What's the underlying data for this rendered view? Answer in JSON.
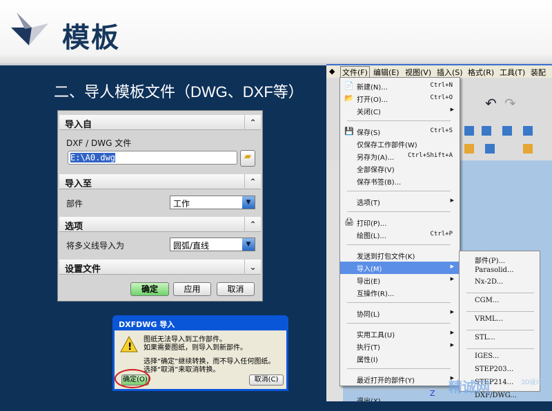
{
  "slide": {
    "title": "模板",
    "subtitle": "二、导人模板文件（DWG、DXF等）"
  },
  "nx_dialog": {
    "sections": [
      {
        "label": "导入自",
        "toggle": "⌃"
      },
      {
        "label": "导入至",
        "toggle": "⌃"
      },
      {
        "label": "选项",
        "toggle": "⌃"
      },
      {
        "label": "设置文件",
        "toggle": "⌄"
      }
    ],
    "file_label": "DXF / DWG 文件",
    "file_value": "E:\\A0.dwg",
    "part_label": "部件",
    "part_value": "工作",
    "polyline_label": "将多义线导入为",
    "polyline_value": "圆弧/直线",
    "buttons": {
      "ok": "确定",
      "apply": "应用",
      "cancel": "取消"
    }
  },
  "alert": {
    "title": "DXFDWG 导入",
    "lines": [
      "图纸无法导入到工作部件。",
      "如果需要图纸，则导入到新部件。",
      "选择“确定”继续转换，而不导入任何图纸。",
      "选择“取消”来取消转换。"
    ],
    "ok": "确定(O)",
    "cancel": "取消(C)"
  },
  "nx": {
    "menubar": [
      "文件(F)",
      "编辑(E)",
      "视图(V)",
      "插入(S)",
      "格式(R)",
      "工具(T)",
      "装配"
    ],
    "file_menu": [
      {
        "label": "新建(N)...",
        "shortcut": "Ctrl+N",
        "icon": "📄"
      },
      {
        "label": "打开(O)...",
        "shortcut": "Ctrl+O",
        "icon": "📂"
      },
      {
        "label": "关闭(C)",
        "arrow": "▶"
      },
      {
        "sep": true
      },
      {
        "label": "保存(S)",
        "shortcut": "Ctrl+S",
        "icon": "💾"
      },
      {
        "label": "仅保存工作部件(W)"
      },
      {
        "label": "另存为(A)...",
        "shortcut": "Ctrl+Shift+A"
      },
      {
        "label": "全部保存(V)"
      },
      {
        "label": "保存书签(B)..."
      },
      {
        "sep": true
      },
      {
        "label": "选项(T)",
        "arrow": "▶"
      },
      {
        "sep": true
      },
      {
        "label": "打印(P)...",
        "icon": "🖨"
      },
      {
        "label": "绘图(L)...",
        "shortcut": "Ctrl+P"
      },
      {
        "sep": true
      },
      {
        "label": "发送到打包文件(K)"
      },
      {
        "label": "导入(M)",
        "arrow": "▶",
        "highlight": true
      },
      {
        "label": "导出(E)",
        "arrow": "▶"
      },
      {
        "label": "互操作(R)..."
      },
      {
        "sep": true
      },
      {
        "label": "协同(L)",
        "arrow": "▶"
      },
      {
        "sep": true
      },
      {
        "label": "实用工具(U)",
        "arrow": "▶"
      },
      {
        "label": "执行(T)",
        "arrow": "▶"
      },
      {
        "label": "属性(I)"
      },
      {
        "sep": true
      },
      {
        "label": "最近打开的部件(Y)",
        "arrow": "▶"
      },
      {
        "sep": true
      },
      {
        "label": "退出(X)"
      }
    ],
    "import_submenu": [
      {
        "label": "部件(P)..."
      },
      {
        "label": "Parasolid..."
      },
      {
        "label": "Nx-2D..."
      },
      {
        "sep": true
      },
      {
        "label": "CGM..."
      },
      {
        "sep": true
      },
      {
        "label": "VRML..."
      },
      {
        "sep": true
      },
      {
        "label": "STL..."
      },
      {
        "sep": true
      },
      {
        "label": "IGES..."
      },
      {
        "label": "STEP203..."
      },
      {
        "label": "STEP214..."
      },
      {
        "label": "DXF/DWG..."
      }
    ],
    "axis_label": "Z"
  },
  "watermark": {
    "name": "精诚网",
    "tag": "3D设计"
  }
}
